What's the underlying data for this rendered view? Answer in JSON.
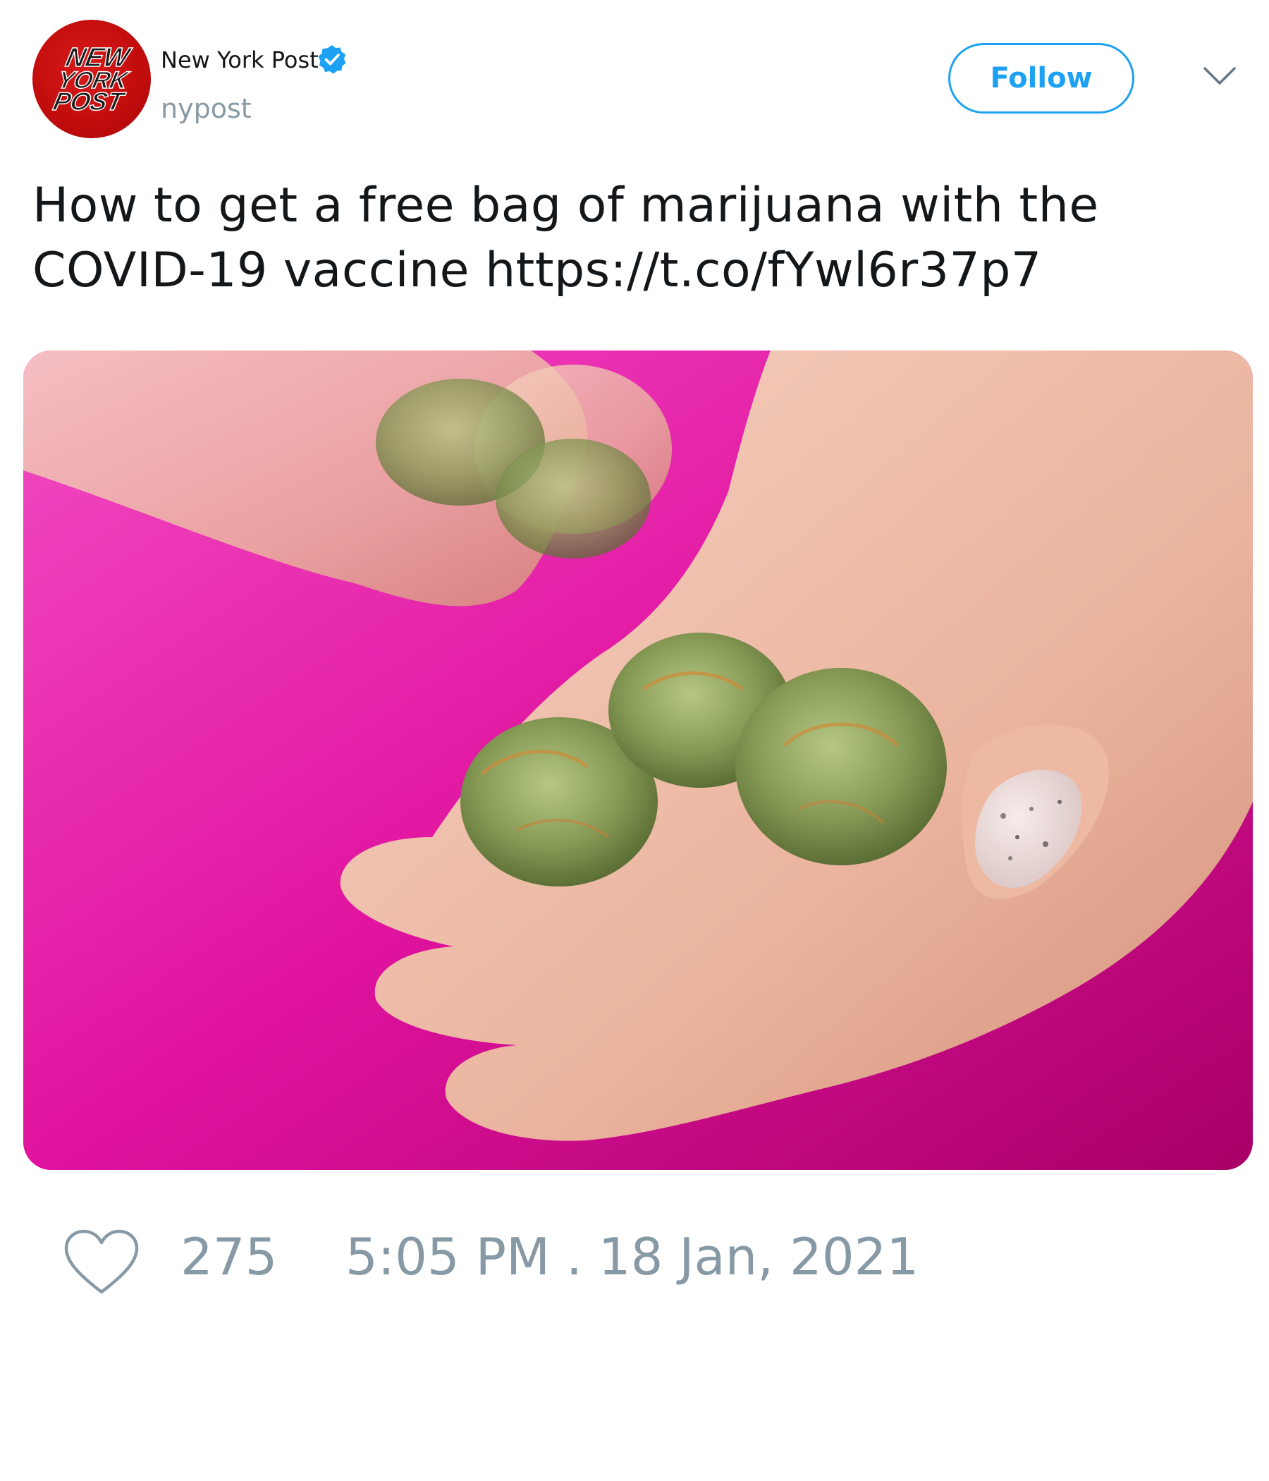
{
  "account": {
    "display_name": "New York Post",
    "handle": "nypost",
    "verified": true,
    "avatar_logo": {
      "line1": "NEW",
      "line2": "YORK",
      "line3": "POST"
    }
  },
  "actions": {
    "follow_label": "Follow",
    "menu_icon": "chevron-down-icon"
  },
  "tweet": {
    "text": "How to get a free bag of marijuana with the COVID-19 vaccine ",
    "link": "https://t.co/fYwl6r37p7",
    "media_icon": "photo"
  },
  "footer": {
    "like_icon": "heart-icon",
    "like_count": "275",
    "timestamp": "5:05 PM . 18 Jan, 2021"
  },
  "colors": {
    "brand_blue": "#1da1f2",
    "muted_text": "#8899a6",
    "body_text": "#14171a",
    "avatar_red": "#c10c0c",
    "photo_background": "#e0139f"
  }
}
